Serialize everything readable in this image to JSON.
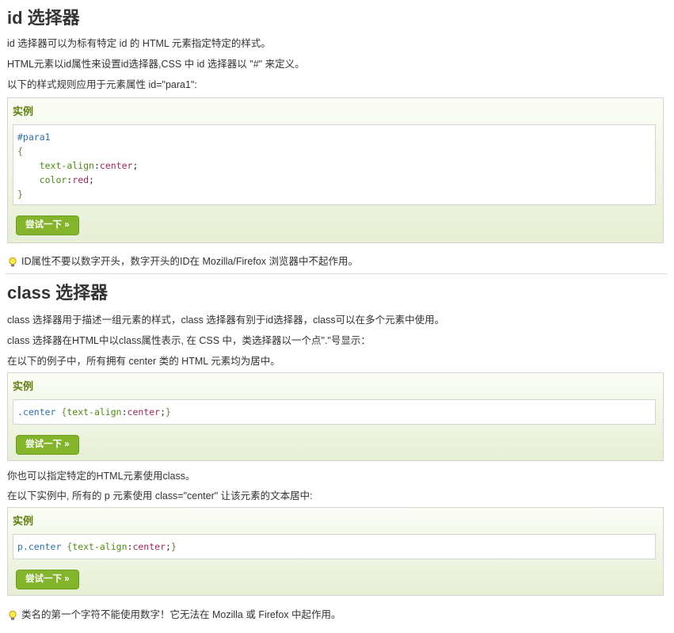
{
  "section_id": {
    "title": "id 选择器",
    "paragraphs": [
      "id 选择器可以为标有特定 id 的 HTML 元素指定特定的样式。",
      "HTML元素以id属性来设置id选择器,CSS 中 id 选择器以 \"#\" 来定义。",
      "以下的样式规则应用于元素属性 id=\"para1\":"
    ],
    "example": {
      "heading": "实例",
      "code": {
        "selector": "#para1",
        "open": "{",
        "lines": [
          {
            "prop": "text-align",
            "val": "center"
          },
          {
            "prop": "color",
            "val": "red"
          }
        ],
        "close": "}"
      },
      "button": "尝试一下 »"
    },
    "tip": "ID属性不要以数字开头，数字开头的ID在 Mozilla/Firefox 浏览器中不起作用。"
  },
  "section_class": {
    "title": "class 选择器",
    "paragraphs": [
      "class 选择器用于描述一组元素的样式，class 选择器有别于id选择器，class可以在多个元素中使用。",
      "class 选择器在HTML中以class属性表示, 在 CSS 中，类选择器以一个点\".\"号显示：",
      "在以下的例子中，所有拥有 center 类的 HTML 元素均为居中。"
    ],
    "example1": {
      "heading": "实例",
      "code": {
        "selector": ".center",
        "open": "{",
        "prop": "text-align",
        "val": "center",
        "close": "}"
      },
      "button": "尝试一下 »"
    },
    "paragraphs2": [
      "你也可以指定特定的HTML元素使用class。",
      "在以下实例中, 所有的 p 元素使用 class=\"center\" 让该元素的文本居中:"
    ],
    "example2": {
      "heading": "实例",
      "code": {
        "selector": "p.center",
        "open": "{",
        "prop": "text-align",
        "val": "center",
        "close": "}"
      },
      "button": "尝试一下 »"
    },
    "tip": "类名的第一个字符不能使用数字！它无法在 Mozilla 或 Firefox 中起作用。"
  },
  "icons": {
    "tip": "lightbulb-icon"
  },
  "colors": {
    "accent": "#84b42c",
    "heading_green": "#617f10",
    "selector_blue": "#2f6fab",
    "value_red": "#a0245f"
  }
}
